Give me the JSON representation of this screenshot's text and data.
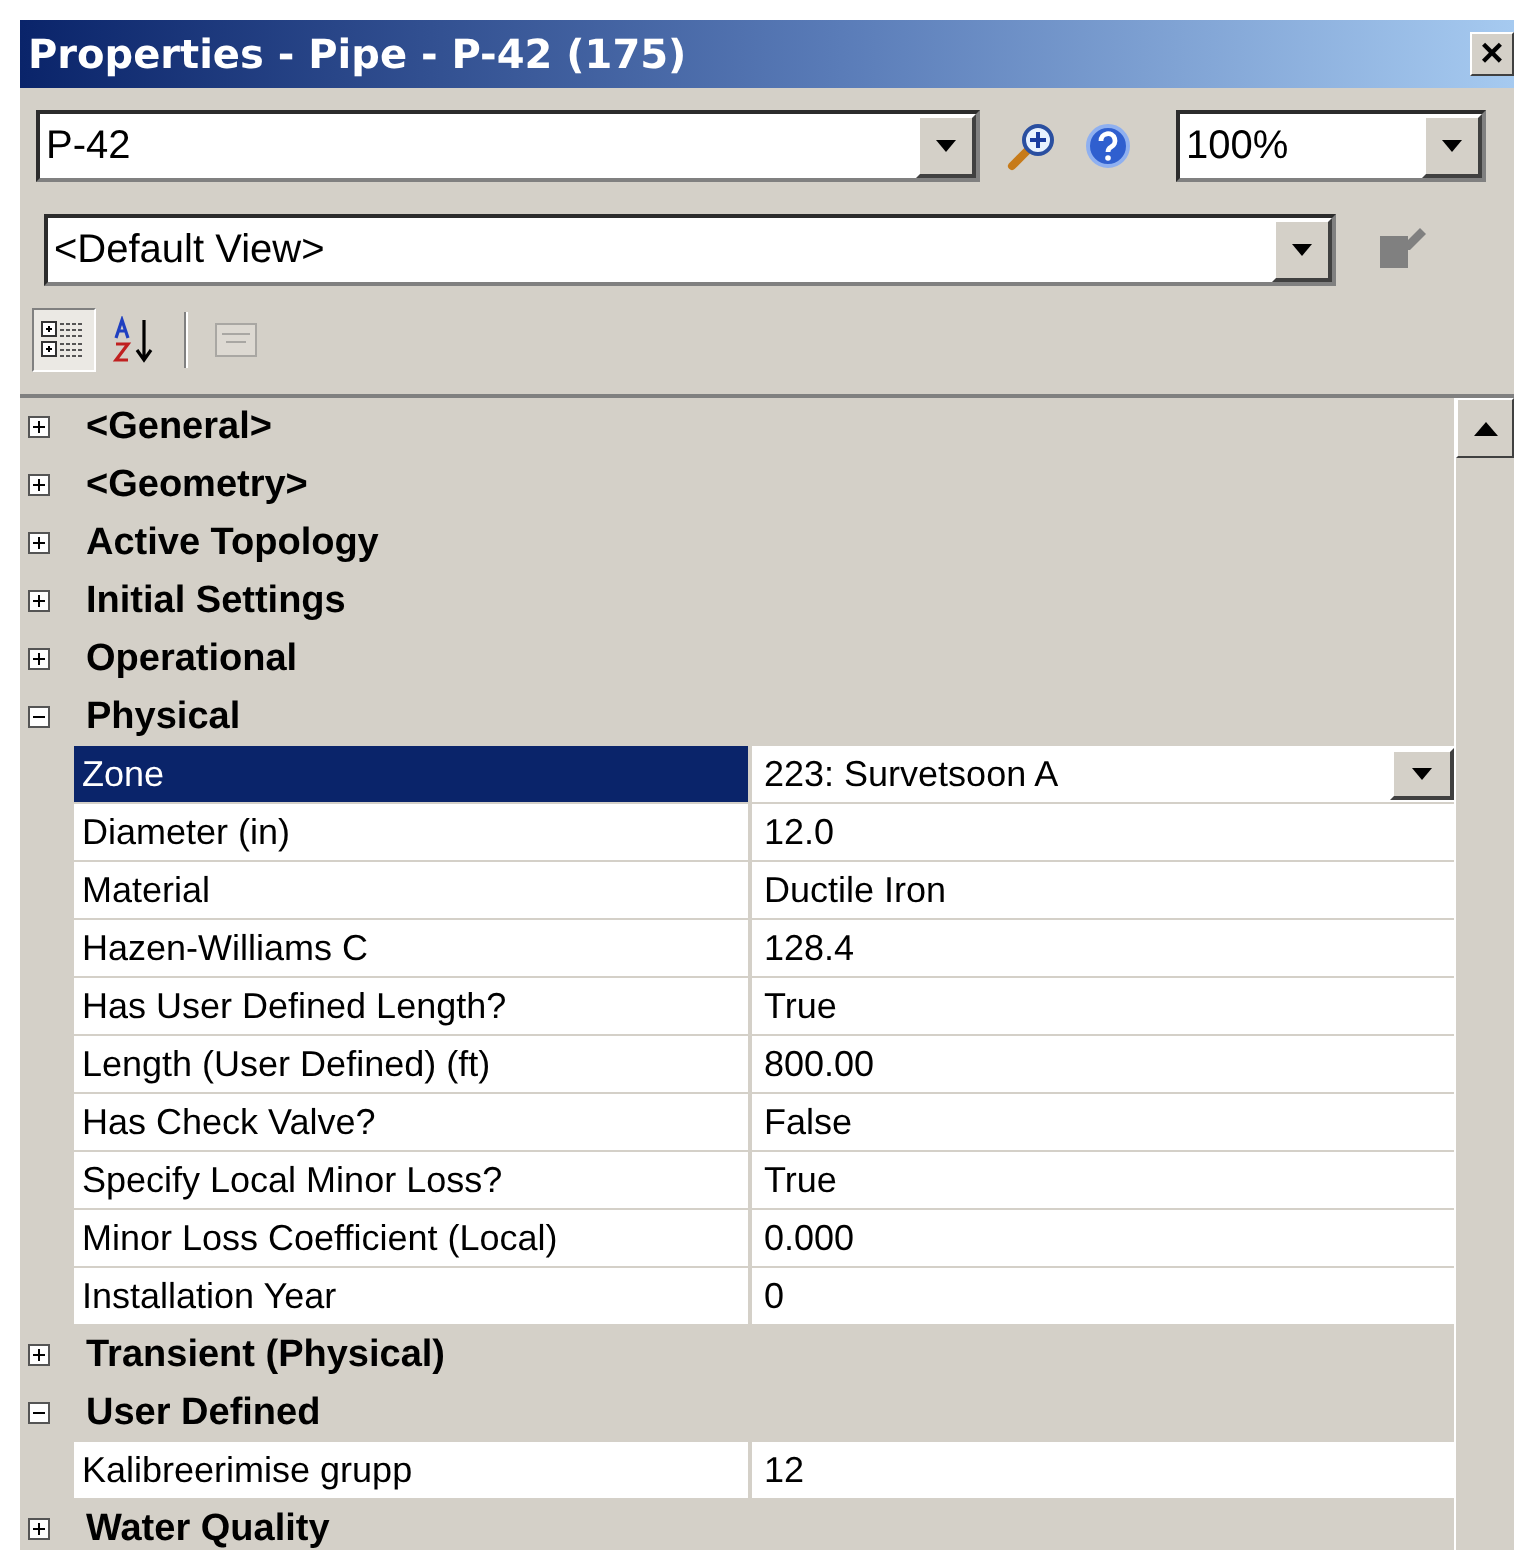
{
  "window": {
    "title": "Properties - Pipe - P-42 (175)",
    "close": "×"
  },
  "element_combo": {
    "value": "P-42"
  },
  "zoom_combo": {
    "value": "100%"
  },
  "view_combo": {
    "value": "<Default View>"
  },
  "toolbar": [
    {
      "kind": "categorized",
      "selected": true,
      "disabled": false
    },
    {
      "kind": "alphabetical",
      "selected": false,
      "disabled": false
    },
    {
      "kind": "pages",
      "selected": false,
      "disabled": true
    }
  ],
  "sections": [
    {
      "label": "<General>",
      "expanded": false
    },
    {
      "label": "<Geometry>",
      "expanded": false
    },
    {
      "label": "Active Topology",
      "expanded": false
    },
    {
      "label": "Initial Settings",
      "expanded": false
    },
    {
      "label": "Operational",
      "expanded": false
    },
    {
      "label": "Physical",
      "expanded": true,
      "children": [
        {
          "name": "Zone",
          "value": "223: Survetsoon A",
          "selected": true,
          "kind": "dropdown"
        },
        {
          "name": "Diameter (in)",
          "value": "12.0",
          "selected": false,
          "kind": "text"
        },
        {
          "name": "Material",
          "value": "Ductile Iron",
          "selected": false,
          "kind": "text"
        },
        {
          "name": "Hazen-Williams C",
          "value": "128.4",
          "selected": false,
          "kind": "text"
        },
        {
          "name": "Has User Defined Length?",
          "value": "True",
          "selected": false,
          "kind": "text"
        },
        {
          "name": "Length (User Defined) (ft)",
          "value": "800.00",
          "selected": false,
          "kind": "text"
        },
        {
          "name": "Has Check Valve?",
          "value": "False",
          "selected": false,
          "kind": "text"
        },
        {
          "name": "Specify Local Minor Loss?",
          "value": "True",
          "selected": false,
          "kind": "text"
        },
        {
          "name": "Minor Loss Coefficient (Local)",
          "value": "0.000",
          "selected": false,
          "kind": "text"
        },
        {
          "name": "Installation Year",
          "value": "0",
          "selected": false,
          "kind": "text"
        }
      ]
    },
    {
      "label": "Transient (Physical)",
      "expanded": false
    },
    {
      "label": "User Defined",
      "expanded": true,
      "children": [
        {
          "name": "Kalibreerimise grupp",
          "value": "12",
          "selected": false,
          "kind": "text"
        }
      ]
    },
    {
      "label": "Water Quality",
      "expanded": false
    }
  ]
}
